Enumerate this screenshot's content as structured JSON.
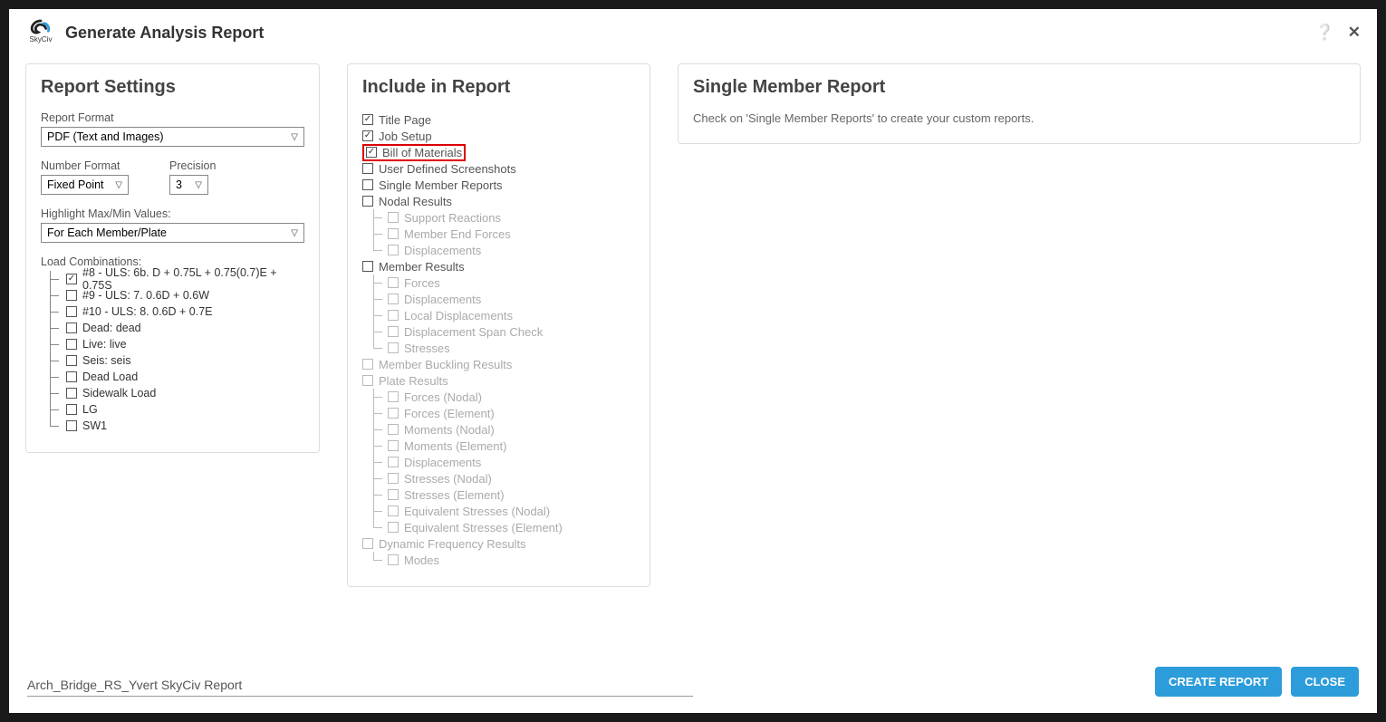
{
  "header": {
    "logo_text": "SkyCiv",
    "title": "Generate Analysis Report"
  },
  "settings": {
    "title": "Report Settings",
    "format_label": "Report Format",
    "format_value": "PDF (Text and Images)",
    "number_format_label": "Number Format",
    "number_format_value": "Fixed Point",
    "precision_label": "Precision",
    "precision_value": "3",
    "highlight_label": "Highlight Max/Min Values:",
    "highlight_value": "For Each Member/Plate",
    "lc_label": "Load Combinations:",
    "lc_items": [
      {
        "label": "#8 - ULS: 6b. D + 0.75L + 0.75(0.7)E + 0.75S",
        "checked": true
      },
      {
        "label": "#9 - ULS: 7. 0.6D + 0.6W",
        "checked": false
      },
      {
        "label": "#10 - ULS: 8. 0.6D + 0.7E",
        "checked": false
      },
      {
        "label": "Dead: dead",
        "checked": false
      },
      {
        "label": "Live: live",
        "checked": false
      },
      {
        "label": "Seis: seis",
        "checked": false
      },
      {
        "label": "Dead Load",
        "checked": false
      },
      {
        "label": "Sidewalk Load",
        "checked": false
      },
      {
        "label": "LG",
        "checked": false
      },
      {
        "label": "SW1",
        "checked": false
      }
    ]
  },
  "include": {
    "title": "Include in Report",
    "items": [
      {
        "label": "Title Page",
        "checked": true,
        "level": 0,
        "disabled": false,
        "hot": false,
        "last": false
      },
      {
        "label": "Job Setup",
        "checked": true,
        "level": 0,
        "disabled": false,
        "hot": false,
        "last": false
      },
      {
        "label": "Bill of Materials",
        "checked": true,
        "level": 0,
        "disabled": false,
        "hot": true,
        "last": false
      },
      {
        "label": "User Defined Screenshots",
        "checked": false,
        "level": 0,
        "disabled": false,
        "hot": false,
        "last": false
      },
      {
        "label": "Single Member Reports",
        "checked": false,
        "level": 0,
        "disabled": false,
        "hot": false,
        "last": false
      },
      {
        "label": "Nodal Results",
        "checked": false,
        "level": 0,
        "disabled": false,
        "hot": false,
        "last": false
      },
      {
        "label": "Support Reactions",
        "checked": false,
        "level": 1,
        "disabled": true,
        "hot": false,
        "last": false
      },
      {
        "label": "Member End Forces",
        "checked": false,
        "level": 1,
        "disabled": true,
        "hot": false,
        "last": false
      },
      {
        "label": "Displacements",
        "checked": false,
        "level": 1,
        "disabled": true,
        "hot": false,
        "last": true
      },
      {
        "label": "Member Results",
        "checked": false,
        "level": 0,
        "disabled": false,
        "hot": false,
        "last": false
      },
      {
        "label": "Forces",
        "checked": false,
        "level": 1,
        "disabled": true,
        "hot": false,
        "last": false
      },
      {
        "label": "Displacements",
        "checked": false,
        "level": 1,
        "disabled": true,
        "hot": false,
        "last": false
      },
      {
        "label": "Local Displacements",
        "checked": false,
        "level": 1,
        "disabled": true,
        "hot": false,
        "last": false
      },
      {
        "label": "Displacement Span Check",
        "checked": false,
        "level": 1,
        "disabled": true,
        "hot": false,
        "last": false
      },
      {
        "label": "Stresses",
        "checked": false,
        "level": 1,
        "disabled": true,
        "hot": false,
        "last": true
      },
      {
        "label": "Member Buckling Results",
        "checked": false,
        "level": 0,
        "disabled": true,
        "hot": false,
        "last": false
      },
      {
        "label": "Plate Results",
        "checked": false,
        "level": 0,
        "disabled": true,
        "hot": false,
        "last": false
      },
      {
        "label": "Forces (Nodal)",
        "checked": false,
        "level": 1,
        "disabled": true,
        "hot": false,
        "last": false
      },
      {
        "label": "Forces (Element)",
        "checked": false,
        "level": 1,
        "disabled": true,
        "hot": false,
        "last": false
      },
      {
        "label": "Moments (Nodal)",
        "checked": false,
        "level": 1,
        "disabled": true,
        "hot": false,
        "last": false
      },
      {
        "label": "Moments (Element)",
        "checked": false,
        "level": 1,
        "disabled": true,
        "hot": false,
        "last": false
      },
      {
        "label": "Displacements",
        "checked": false,
        "level": 1,
        "disabled": true,
        "hot": false,
        "last": false
      },
      {
        "label": "Stresses (Nodal)",
        "checked": false,
        "level": 1,
        "disabled": true,
        "hot": false,
        "last": false
      },
      {
        "label": "Stresses (Element)",
        "checked": false,
        "level": 1,
        "disabled": true,
        "hot": false,
        "last": false
      },
      {
        "label": "Equivalent Stresses (Nodal)",
        "checked": false,
        "level": 1,
        "disabled": true,
        "hot": false,
        "last": false
      },
      {
        "label": "Equivalent Stresses (Element)",
        "checked": false,
        "level": 1,
        "disabled": true,
        "hot": false,
        "last": true
      },
      {
        "label": "Dynamic Frequency Results",
        "checked": false,
        "level": 0,
        "disabled": true,
        "hot": false,
        "last": false
      },
      {
        "label": "Modes",
        "checked": false,
        "level": 1,
        "disabled": true,
        "hot": false,
        "last": true
      }
    ]
  },
  "single": {
    "title": "Single Member Report",
    "hint": "Check on 'Single Member Reports' to create your custom reports."
  },
  "footer": {
    "report_name": "Arch_Bridge_RS_Yvert SkyCiv Report",
    "create": "CREATE REPORT",
    "close": "CLOSE"
  }
}
